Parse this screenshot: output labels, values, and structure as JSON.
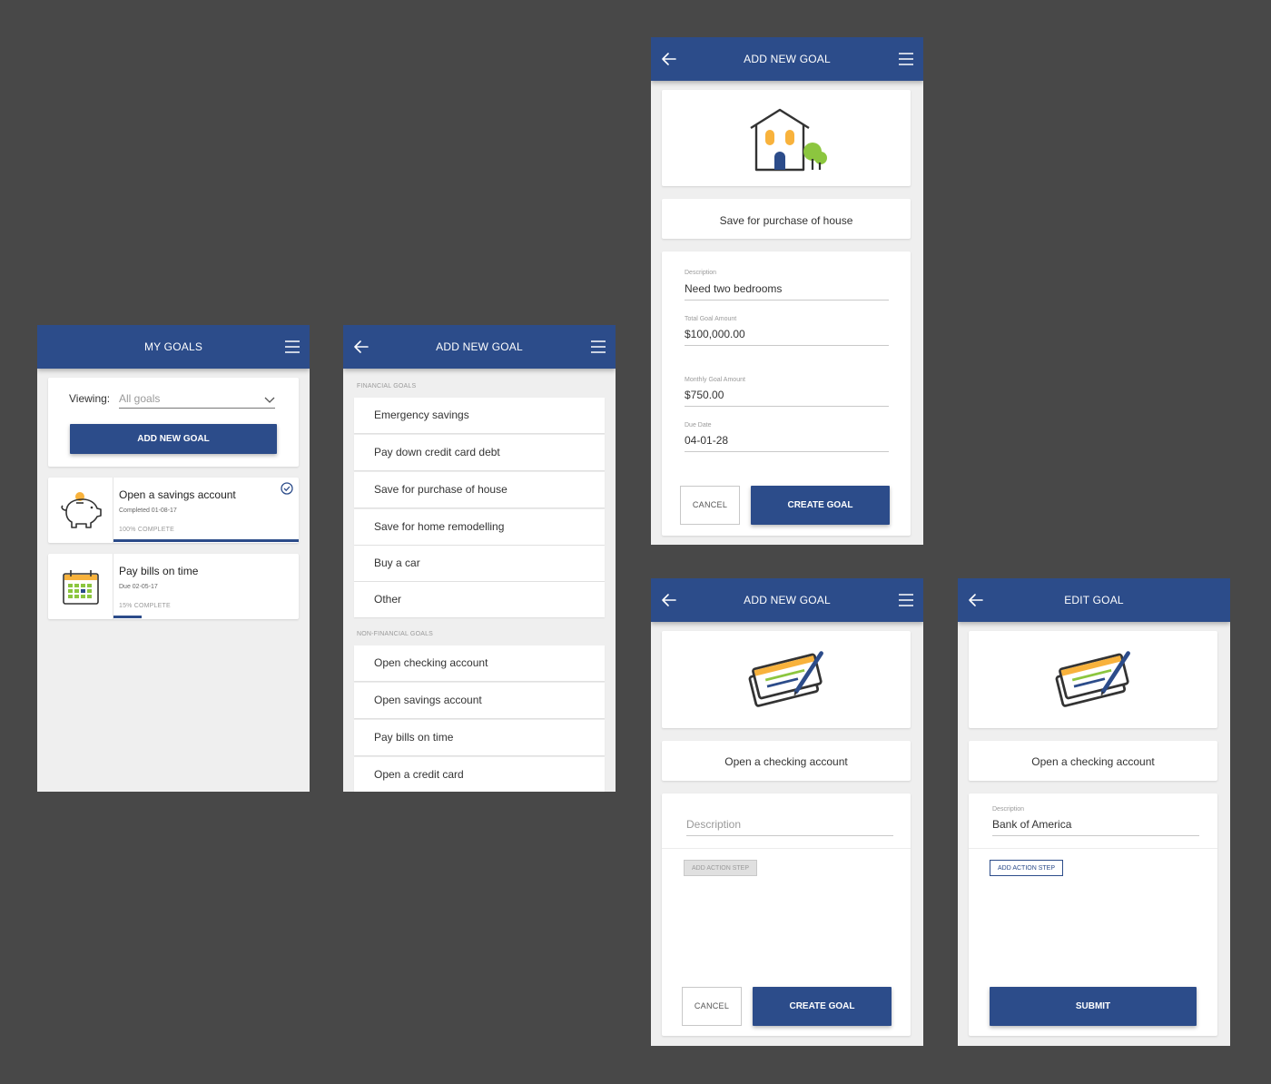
{
  "colors": {
    "primary": "#2c4c8a",
    "background": "#484848",
    "screen_bg": "#efefef",
    "orange": "#f8b23c",
    "green": "#8cc63f"
  },
  "screen1": {
    "title": "MY GOALS",
    "viewing_label": "Viewing:",
    "viewing_value": "All goals",
    "add_button": "ADD NEW GOAL",
    "goals": [
      {
        "title": "Open a savings account",
        "sub": "Completed 01-08-17",
        "pct_label": "100% COMPLETE",
        "progress": 1.0,
        "icon": "piggy-bank-icon"
      },
      {
        "title": "Pay bills on time",
        "sub": "Due 02-05-17",
        "pct_label": "15% COMPLETE",
        "progress": 0.15,
        "icon": "calendar-icon"
      }
    ]
  },
  "screen2": {
    "title": "ADD NEW GOAL",
    "financial_label": "FINANCIAL GOALS",
    "financial": [
      "Emergency savings",
      "Pay down credit card debt",
      "Save for purchase of house",
      "Save for home remodelling",
      "Buy a car",
      "Other"
    ],
    "nonfinancial_label": "NON-FINANCIAL GOALS",
    "nonfinancial": [
      "Open checking account",
      "Open savings account",
      "Pay bills on time",
      "Open a credit card"
    ]
  },
  "screen3": {
    "title": "ADD NEW GOAL",
    "goal_name": "Save for purchase of house",
    "description_label": "Description",
    "description": "Need two bedrooms",
    "total_label": "Total Goal Amount",
    "total": "$100,000.00",
    "monthly_label": "Monthly Goal Amount",
    "monthly": "$750.00",
    "due_label": "Due Date",
    "due": "04-01-28",
    "cancel": "CANCEL",
    "create": "CREATE GOAL"
  },
  "screen4": {
    "title": "ADD NEW GOAL",
    "goal_name": "Open a checking account",
    "description_placeholder": "Description",
    "action_step": "ADD ACTION STEP",
    "cancel": "CANCEL",
    "create": "CREATE GOAL"
  },
  "screen5": {
    "title": "EDIT GOAL",
    "goal_name": "Open a checking account",
    "description_label": "Description",
    "description": "Bank of America",
    "action_step": "ADD ACTION STEP",
    "submit": "SUBMIT"
  }
}
